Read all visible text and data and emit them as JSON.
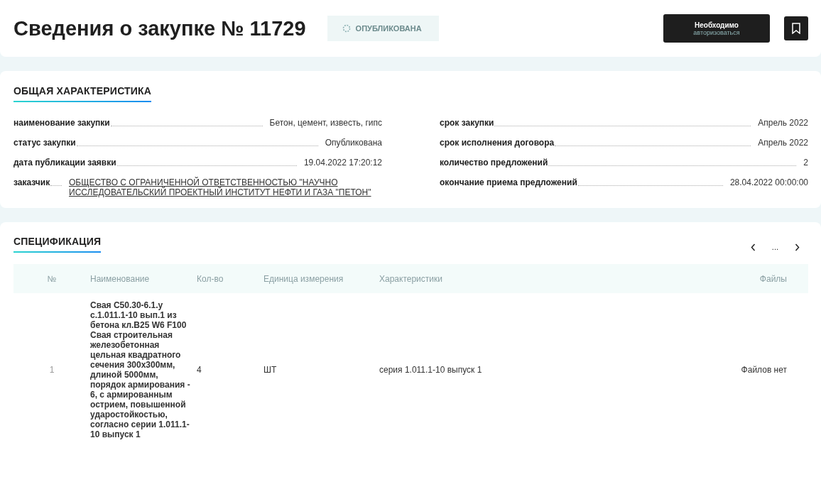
{
  "header": {
    "title": "Сведения о закупке № 11729",
    "status_badge": "ОПУБЛИКОВАНА",
    "auth_button": {
      "line_1": "Необходимо",
      "line_2": "авторизоваться"
    }
  },
  "general": {
    "title": "ОБЩАЯ ХАРАКТЕРИСТИКА",
    "left": [
      {
        "label": "наименование закупки",
        "value": "Бетон, цемент, известь, гипс",
        "kind": "text"
      },
      {
        "label": "статус закупки",
        "value": "Опубликована",
        "kind": "text"
      },
      {
        "label": "дата публикации заявки",
        "value": "19.04.2022 17:20:12",
        "kind": "text"
      },
      {
        "label": "заказчик",
        "value": "ОБЩЕСТВО С ОГРАНИЧЕННОЙ ОТВЕТСТВЕННОСТЬЮ \"НАУЧНО ИССЛЕДОВАТЕЛЬСКИЙ ПРОЕКТНЫЙ ИНСТИТУТ НЕФТИ И ГАЗА \"ПЕТОН\"",
        "kind": "link"
      }
    ],
    "right": [
      {
        "label": "срок закупки",
        "value": "Апрель 2022"
      },
      {
        "label": "срок исполнения договора",
        "value": "Апрель 2022"
      },
      {
        "label": "количество предложений",
        "value": "2"
      },
      {
        "label": "окончание приема предложений",
        "value": "28.04.2022 00:00:00"
      }
    ]
  },
  "specification": {
    "title": "СПЕЦИФИКАЦИЯ",
    "pagination": {
      "page": "..."
    },
    "table": {
      "columns": [
        "№",
        "Наименование",
        "Кол-во",
        "Единица измерения",
        "Характеристики",
        "Файлы"
      ],
      "rows": [
        [
          "1",
          "Свая С50.30-6.1.у с.1.011.1-10 вып.1 из бетона кл.В25 W6 F100 Свая строительная железобетонная цельная квадратного сечения 300х300мм, длиной 5000мм, порядок армирования - 6, с армированным острием, повышенной ударостойкостью, согласно серии 1.011.1-10 выпуск 1",
          "4",
          "ШТ",
          "серия 1.011.1-10 выпуск 1",
          "Файлов нет"
        ]
      ]
    }
  }
}
